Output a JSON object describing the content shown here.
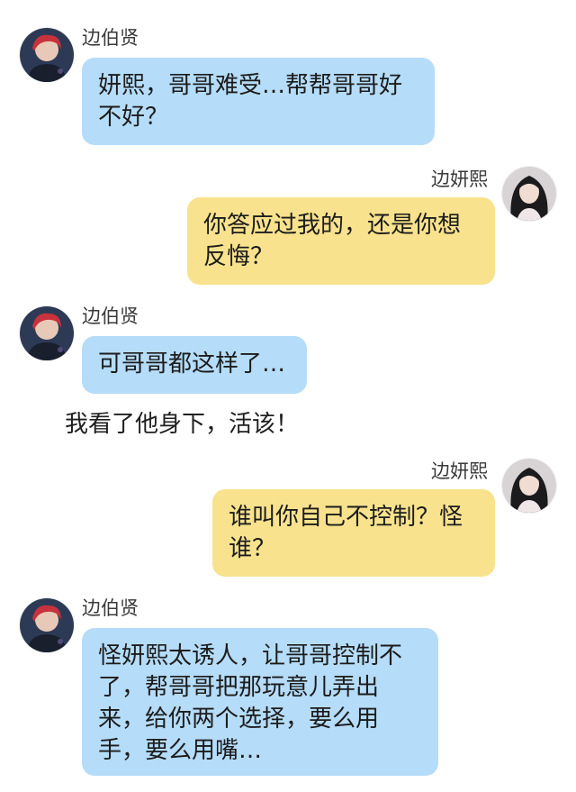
{
  "participants": {
    "left": {
      "name": "边伯贤",
      "avatar_icon": "male-avatar"
    },
    "right": {
      "name": "边妍熙",
      "avatar_icon": "female-avatar"
    }
  },
  "colors": {
    "left_bubble": "#b5dcf8",
    "right_bubble": "#f8e28d"
  },
  "messages": [
    {
      "side": "left",
      "name": "边伯贤",
      "text": "妍熙，哥哥难受…帮帮哥哥好\n不好？"
    },
    {
      "side": "right",
      "name": "边妍熙",
      "text": "你答应过我的，还是你想\n反悔？"
    },
    {
      "side": "left",
      "name": "边伯贤",
      "text": "可哥哥都这样了…"
    },
    {
      "side": "narration",
      "text": "我看了他身下，活该！"
    },
    {
      "side": "right",
      "name": "边妍熙",
      "text": "谁叫你自己不控制？怪\n谁？"
    },
    {
      "side": "left",
      "name": "边伯贤",
      "text": "怪妍熙太诱人，让哥哥控制不\n了，帮哥哥把那玩意儿弄出\n来，给你两个选择，要么用\n手，要么用嘴…"
    }
  ]
}
